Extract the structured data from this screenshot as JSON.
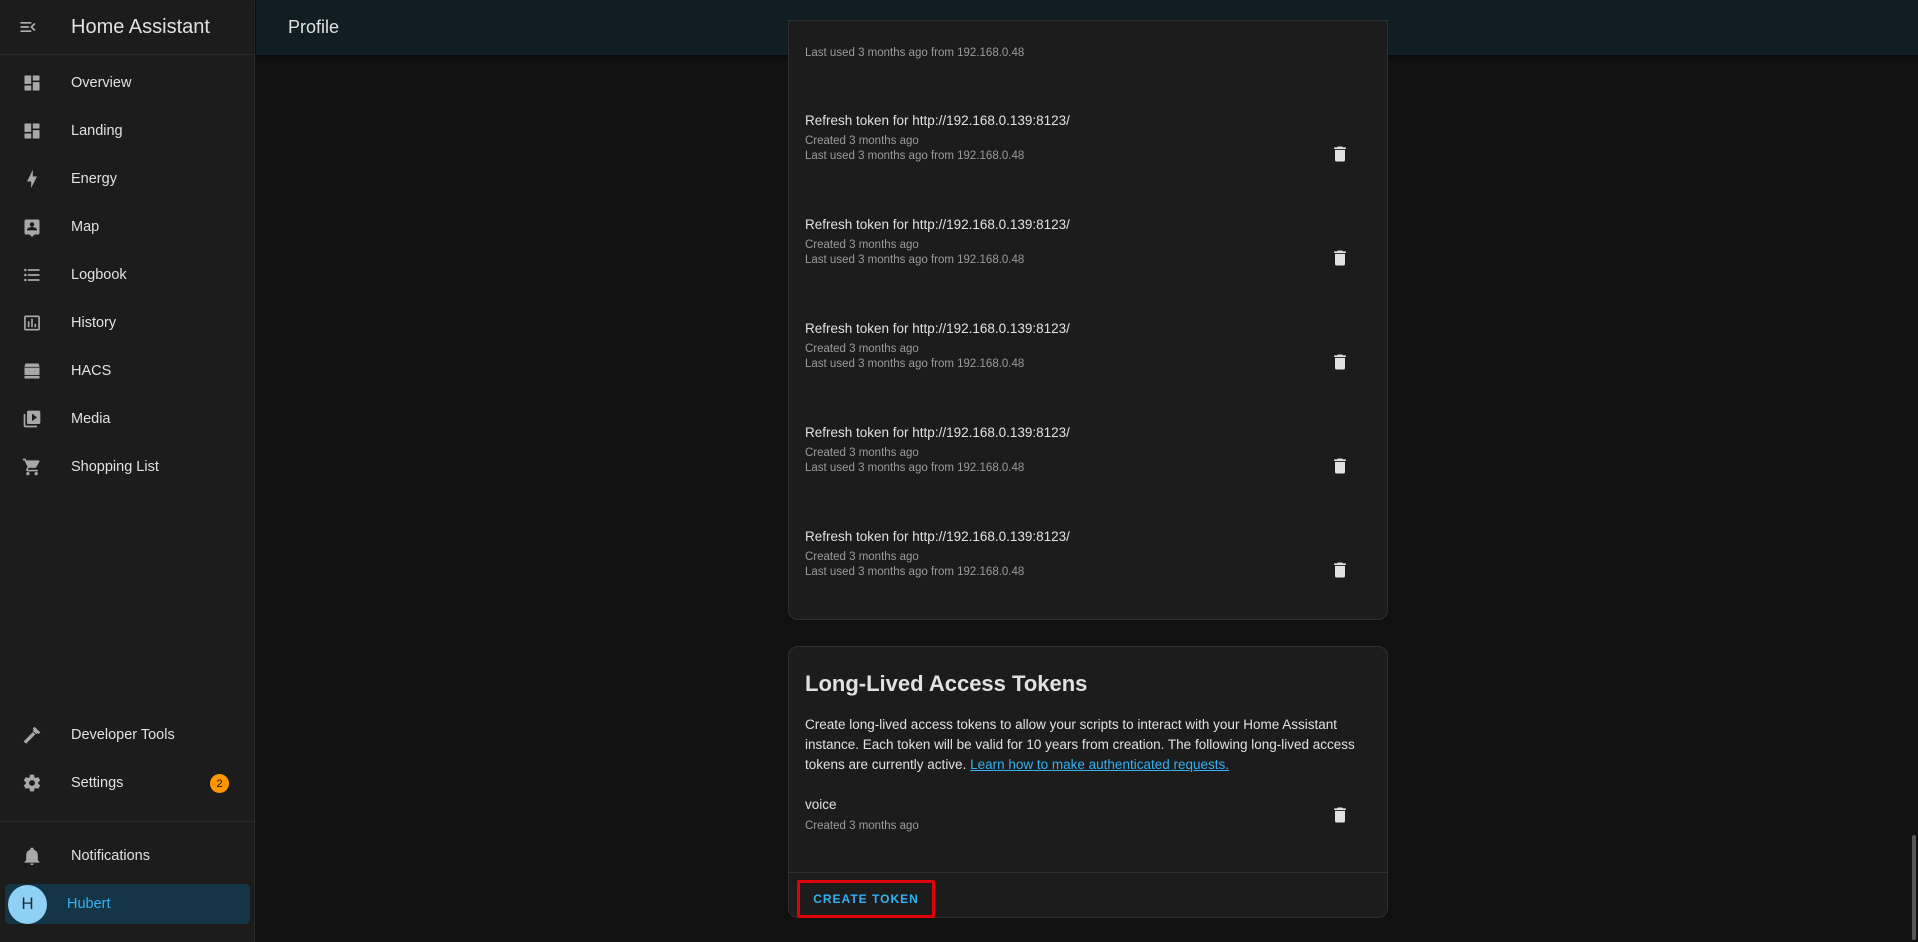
{
  "app": {
    "title": "Home Assistant",
    "page_title": "Profile"
  },
  "sidebar": {
    "items": [
      {
        "label": "Overview",
        "icon": "dashboard-icon"
      },
      {
        "label": "Landing",
        "icon": "dashboard-icon"
      },
      {
        "label": "Energy",
        "icon": "lightning-bolt-icon"
      },
      {
        "label": "Map",
        "icon": "map-account-icon"
      },
      {
        "label": "Logbook",
        "icon": "list-icon"
      },
      {
        "label": "History",
        "icon": "chart-box-icon"
      },
      {
        "label": "HACS",
        "icon": "hacs-icon"
      },
      {
        "label": "Media",
        "icon": "play-box-icon"
      },
      {
        "label": "Shopping List",
        "icon": "cart-icon"
      }
    ],
    "developer_tools": "Developer Tools",
    "settings": "Settings",
    "settings_badge": "2",
    "notifications": "Notifications",
    "user_name": "Hubert",
    "user_initial": "H"
  },
  "refresh_tokens": {
    "partial_last_line": "Last used 3 months ago from 192.168.0.48",
    "tokens": [
      {
        "name": "Refresh token for http://192.168.0.139:8123/",
        "created": "Created 3 months ago",
        "last_used": "Last used 3 months ago from 192.168.0.48"
      },
      {
        "name": "Refresh token for http://192.168.0.139:8123/",
        "created": "Created 3 months ago",
        "last_used": "Last used 3 months ago from 192.168.0.48"
      },
      {
        "name": "Refresh token for http://192.168.0.139:8123/",
        "created": "Created 3 months ago",
        "last_used": "Last used 3 months ago from 192.168.0.48"
      },
      {
        "name": "Refresh token for http://192.168.0.139:8123/",
        "created": "Created 3 months ago",
        "last_used": "Last used 3 months ago from 192.168.0.48"
      },
      {
        "name": "Refresh token for http://192.168.0.139:8123/",
        "created": "Created 3 months ago",
        "last_used": "Last used 3 months ago from 192.168.0.48"
      }
    ]
  },
  "long_lived": {
    "title": "Long-Lived Access Tokens",
    "description": "Create long-lived access tokens to allow your scripts to interact with your Home Assistant instance. Each token will be valid for 10 years from creation. The following long-lived access tokens are currently active.",
    "link_text": "Learn how to make authenticated requests.",
    "tokens": [
      {
        "name": "voice",
        "created": "Created 3 months ago"
      }
    ],
    "create_button": "CREATE TOKEN"
  },
  "colors": {
    "accent": "#33b1f2",
    "badge": "#ff9800",
    "highlight_box": "#e0000b"
  }
}
